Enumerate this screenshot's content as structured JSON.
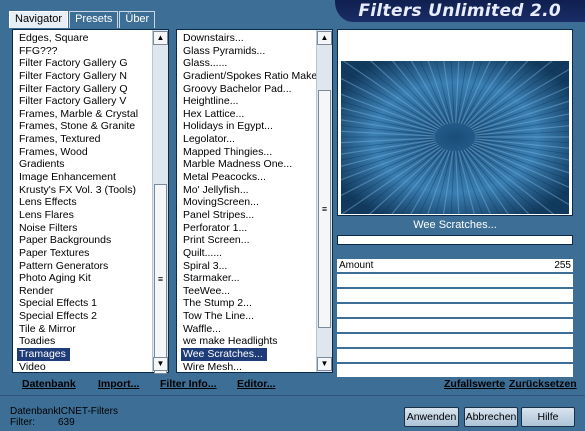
{
  "app": {
    "title": "Filters Unlimited 2.0"
  },
  "tabs": [
    {
      "label": "Navigator"
    },
    {
      "label": "Presets"
    },
    {
      "label": "Über"
    }
  ],
  "categories": [
    "Edges, Square",
    "FFG???",
    "Filter Factory Gallery G",
    "Filter Factory Gallery N",
    "Filter Factory Gallery Q",
    "Filter Factory Gallery V",
    "Frames, Marble & Crystal",
    "Frames, Stone & Granite",
    "Frames, Textured",
    "Frames, Wood",
    "Gradients",
    "Image Enhancement",
    "Krusty's FX Vol. 3 (Tools)",
    "Lens Effects",
    "Lens Flares",
    "Noise Filters",
    "Paper Backgrounds",
    "Paper Textures",
    "Pattern Generators",
    "Photo Aging Kit",
    "Render",
    "Special Effects 1",
    "Special Effects 2",
    "Tile & Mirror",
    "Toadies",
    "Tramages",
    "Video"
  ],
  "selected_category": "Tramages",
  "filters": [
    "Downstairs...",
    "Glass Pyramids...",
    "Glass......",
    "Gradient/Spokes Ratio Maker...",
    "Groovy Bachelor Pad...",
    "Heightline...",
    "Hex Lattice...",
    "Holidays in Egypt...",
    "Legolator...",
    "Mapped Thingies...",
    "Marble Madness One...",
    "Metal Peacocks...",
    "Mo' Jellyfish...",
    "MovingScreen...",
    "Panel Stripes...",
    "Perforator 1...",
    "Print Screen...",
    "Quilt......",
    "Spiral 3...",
    "Starmaker...",
    "TeeWee...",
    "The Stump 2...",
    "Tow The Line...",
    "Waffle...",
    "we make Headlights",
    "Wee Scratches...",
    "Wire Mesh..."
  ],
  "selected_filter": "Wee Scratches...",
  "preview": {
    "filter_name": "Wee Scratches..."
  },
  "parameters": [
    {
      "label": "Amount",
      "value": "255",
      "fraction": 1.0
    }
  ],
  "empty_parameter_rows": 7,
  "links": {
    "database": "Datenbank",
    "import": "Import...",
    "filter_info": "Filter Info...",
    "editor": "Editor...",
    "random": "Zufallswerte",
    "reset": "Zurücksetzen"
  },
  "status": {
    "database_label": "Datenbank:",
    "database_value": "ICNET-Filters",
    "filter_label": "Filter:",
    "filter_value": "639"
  },
  "buttons": {
    "apply": "Anwenden",
    "cancel": "Abbrechen",
    "help": "Hilfe"
  },
  "colors": {
    "background": "#3d6f96",
    "banner": "#0f1f4f",
    "selection": "#1e3c78"
  }
}
